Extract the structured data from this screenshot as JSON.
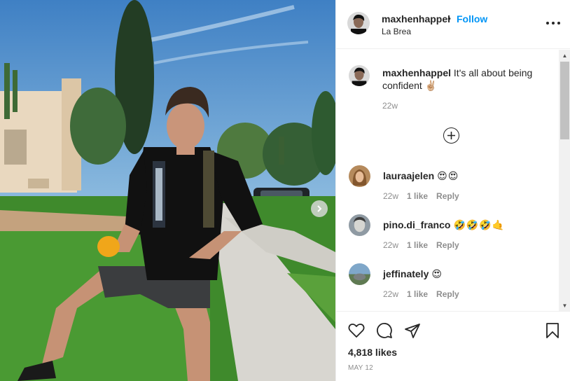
{
  "post": {
    "username": "maxhenhappel",
    "dot": "•",
    "follow_label": "Follow",
    "location": "La Brea",
    "caption_user": "maxhenhappel",
    "caption_text": "It's all about being confident ✌🏼",
    "caption_time": "22w",
    "likes": "4,818 likes",
    "date": "MAY 12"
  },
  "comments": [
    {
      "username": "lauraajelen",
      "emoji": "😍😍",
      "time": "22w",
      "likes": "1 like",
      "reply": "Reply"
    },
    {
      "username": "pino.di_franco",
      "emoji": "🤣🤣🤣🤙",
      "time": "22w",
      "likes": "1 like",
      "reply": "Reply"
    },
    {
      "username": "jeffinately",
      "emoji": "😍",
      "time": "22w",
      "likes": "1 like",
      "reply": "Reply"
    }
  ],
  "icons": {
    "more": "more-options-icon",
    "load_more": "plus-circle-icon",
    "like": "heart-icon",
    "comment": "comment-bubble-icon",
    "share": "paper-plane-icon",
    "save": "bookmark-icon",
    "next": "chevron-right-icon"
  },
  "colors": {
    "link": "#0095f6",
    "secondary_text": "#8e8e8e",
    "primary_text": "#262626"
  }
}
